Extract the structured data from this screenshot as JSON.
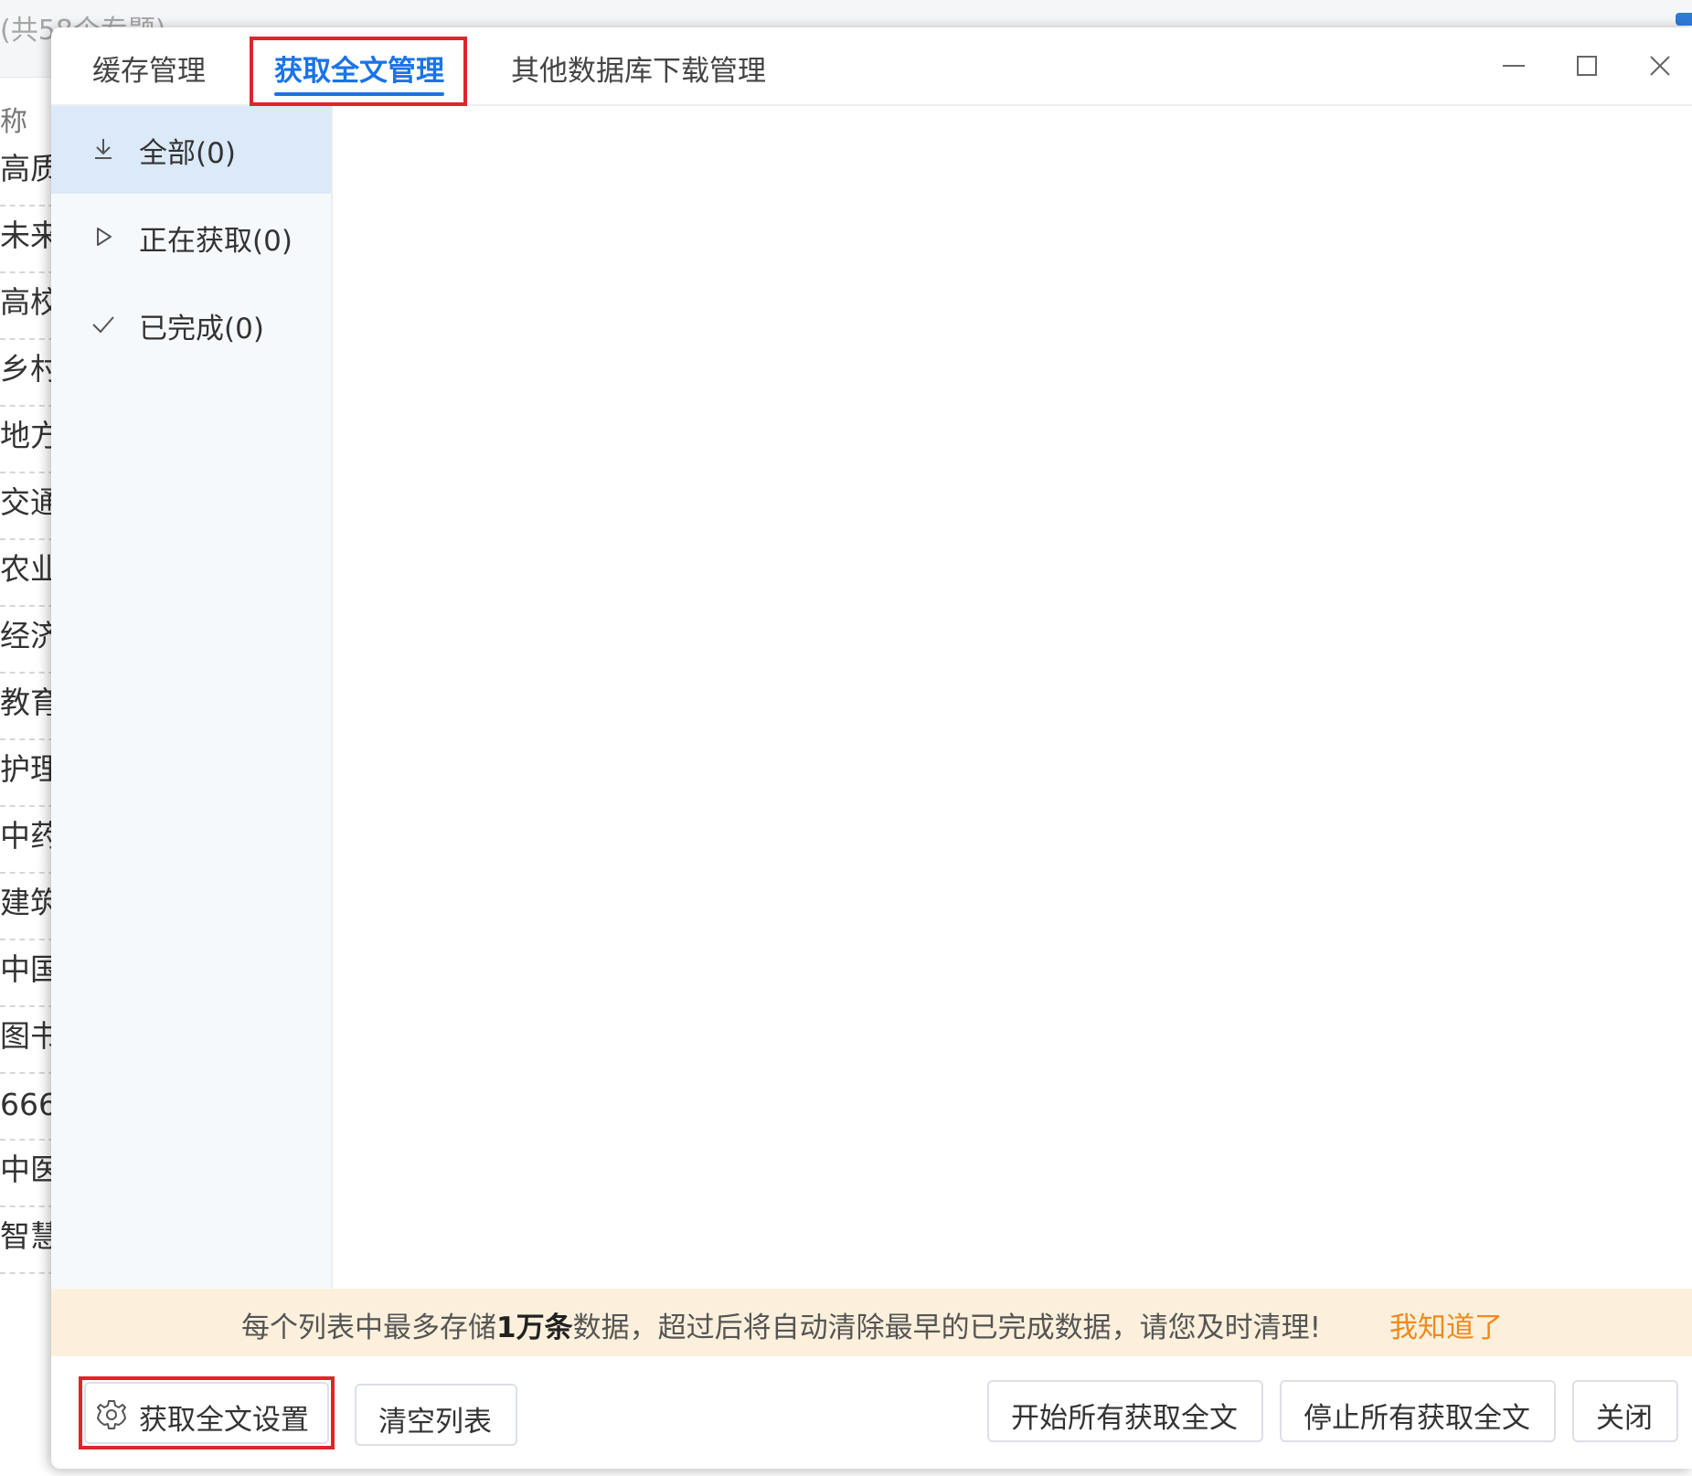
{
  "background": {
    "topic_count": "(共58个专题)",
    "name_header": "称",
    "rows": [
      "高质",
      "未来",
      "高校",
      "乡村",
      "地方",
      "交通",
      "农业",
      "经济",
      "教育",
      "护理",
      "中药",
      "建筑",
      "中国",
      "图书",
      "666",
      "中医",
      "智慧"
    ]
  },
  "dialog": {
    "tabs": [
      {
        "label": "缓存管理",
        "active": false
      },
      {
        "label": "获取全文管理",
        "active": true
      },
      {
        "label": "其他数据库下载管理",
        "active": false
      }
    ],
    "sidebar": [
      {
        "label": "全部(0)",
        "icon": "download-icon",
        "active": true
      },
      {
        "label": "正在获取(0)",
        "icon": "play-icon",
        "active": false
      },
      {
        "label": "已完成(0)",
        "icon": "check-icon",
        "active": false
      }
    ],
    "notice": {
      "prefix": "每个列表中最多存储",
      "emphasis": "1万条",
      "suffix": "数据，超过后将自动清除最早的已完成数据，请您及时清理!",
      "ack": "我知道了"
    },
    "footer": {
      "settings": "获取全文设置",
      "clear": "清空列表",
      "start_all": "开始所有获取全文",
      "stop_all": "停止所有获取全文",
      "close": "关闭"
    }
  },
  "colors": {
    "accent": "#1a73e8",
    "highlight_border": "#e0242b",
    "notice_bg": "#fcf0dc",
    "notice_ack": "#f08a1c",
    "sidebar_active": "#dbe9f8"
  }
}
